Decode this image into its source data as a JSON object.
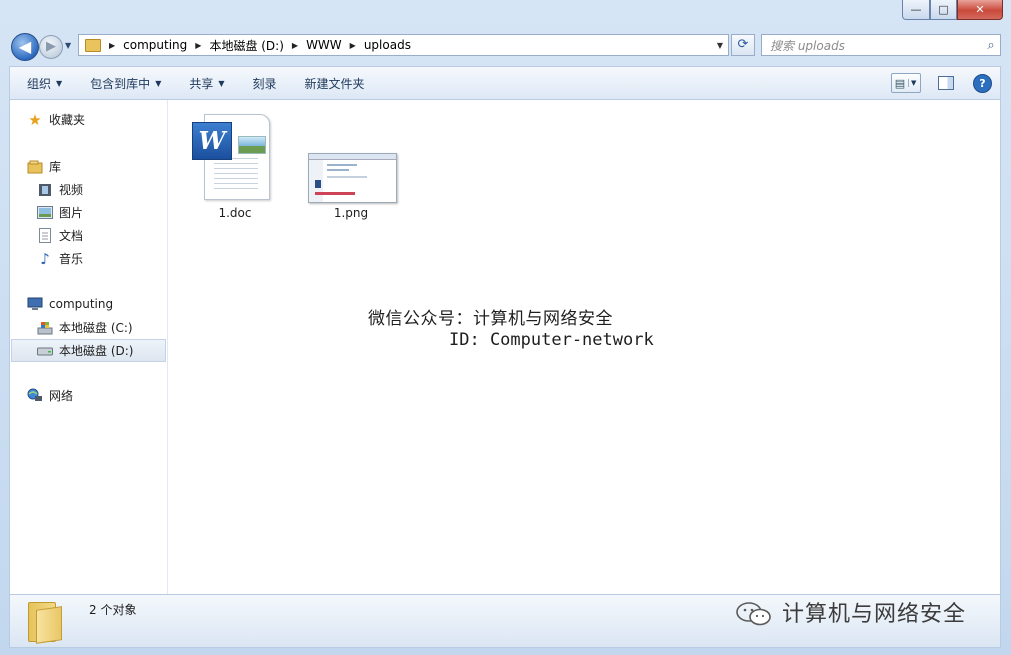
{
  "window": {
    "caption_minimize": "—",
    "caption_maximize": "□",
    "caption_close": "✕"
  },
  "nav": {
    "back_glyph": "◀",
    "forward_glyph": "▶",
    "breadcrumb": [
      "computing",
      "本地磁盘 (D:)",
      "WWW",
      "uploads"
    ],
    "refresh_glyph": "⟳",
    "search_placeholder": "搜索 uploads"
  },
  "toolbar": {
    "items": [
      {
        "label": "组织",
        "has_menu": true
      },
      {
        "label": "包含到库中",
        "has_menu": true
      },
      {
        "label": "共享",
        "has_menu": true
      },
      {
        "label": "刻录",
        "has_menu": false
      },
      {
        "label": "新建文件夹",
        "has_menu": false
      }
    ],
    "help_glyph": "?"
  },
  "sidebar": {
    "favorites": {
      "label": "收藏夹",
      "icon": "star-icon"
    },
    "libraries": {
      "label": "库",
      "icon": "library-icon"
    },
    "library_items": [
      {
        "label": "视频",
        "icon": "video-icon"
      },
      {
        "label": "图片",
        "icon": "picture-icon"
      },
      {
        "label": "文档",
        "icon": "document-icon"
      },
      {
        "label": "音乐",
        "icon": "music-icon"
      }
    ],
    "computer": {
      "label": "computing",
      "icon": "computer-icon"
    },
    "drives": [
      {
        "label": "本地磁盘 (C:)",
        "icon": "drive-c-icon"
      },
      {
        "label": "本地磁盘 (D:)",
        "icon": "drive-icon",
        "selected": true
      }
    ],
    "network": {
      "label": "网络",
      "icon": "network-icon"
    }
  },
  "files": [
    {
      "name": "1.doc",
      "type": "word-document"
    },
    {
      "name": "1.png",
      "type": "png-image"
    }
  ],
  "overlay": {
    "line1": "微信公众号：计算机与网络安全",
    "line2": "ID: Computer-network"
  },
  "status": {
    "count": "2 个对象",
    "brand": "计算机与网络安全"
  }
}
